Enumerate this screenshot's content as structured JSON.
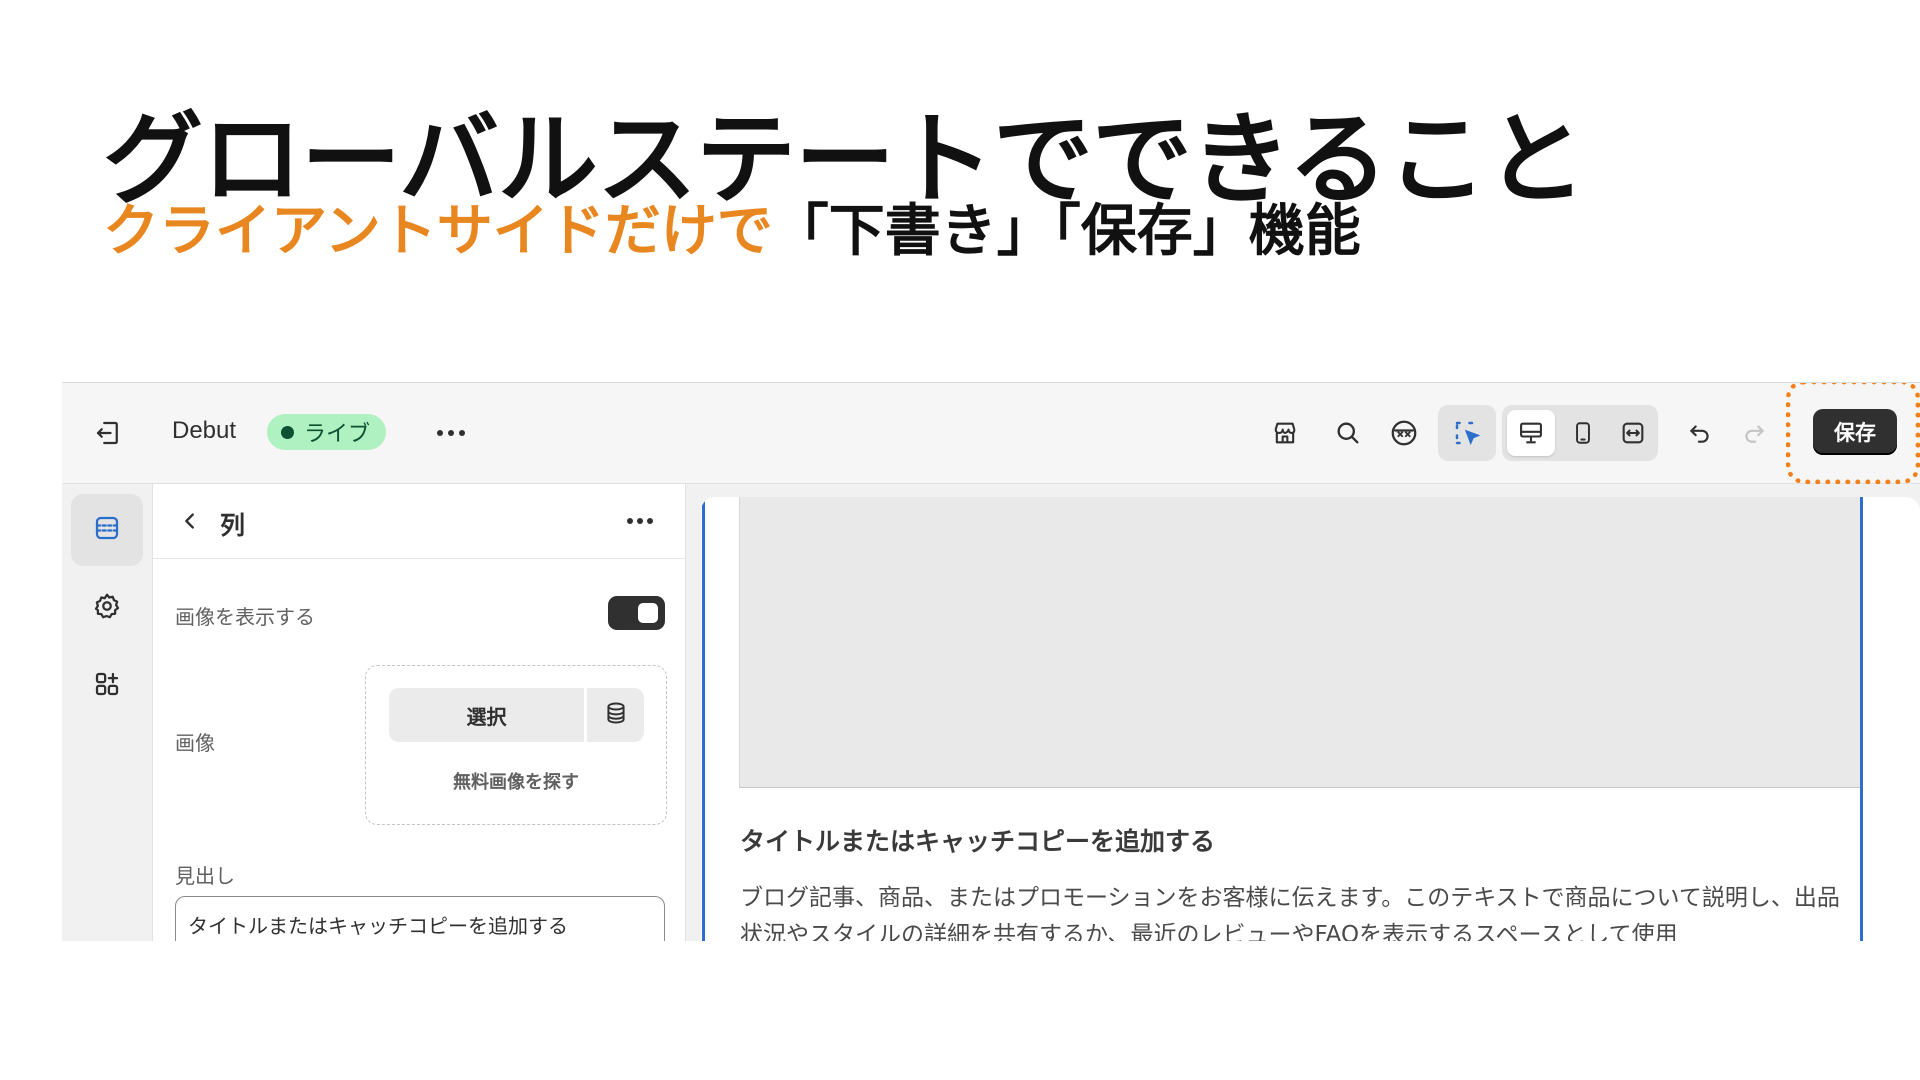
{
  "slide": {
    "title": "グローバルステートでできること",
    "subtitle_accent": "クライアントサイドだけで",
    "subtitle_rest": "「下書き」「保存」機能"
  },
  "topbar": {
    "theme_name": "Debut",
    "status_badge": "ライブ",
    "save_label": "保存",
    "icons": [
      "exit-icon",
      "more-horizontal-icon",
      "store-icon",
      "search-icon",
      "inspector-icon",
      "select-element-icon",
      "desktop-icon",
      "mobile-icon",
      "fullscreen-icon",
      "undo-icon",
      "redo-icon"
    ]
  },
  "sidebar": {
    "items": [
      "sections-icon",
      "settings-icon",
      "apps-icon"
    ]
  },
  "panel": {
    "title": "列",
    "show_image_label": "画像を表示する",
    "show_image_enabled": true,
    "image_label": "画像",
    "select_label": "選択",
    "free_images_label": "無料画像を探す",
    "heading_label": "見出し",
    "heading_value": "タイトルまたはキャッチコピーを追加する"
  },
  "preview": {
    "heading": "タイトルまたはキャッチコピーを追加する",
    "body": "ブログ記事、商品、またはプロモーションをお客様に伝えます。このテキストで商品について説明し、出品状況やスタイルの詳細を共有するか、最近のレビューやFAQを表示するスペースとして使用"
  },
  "colors": {
    "accent_orange": "#e8861f",
    "badge_green": "#aff1c0",
    "selection_blue": "#2c6ecb"
  }
}
